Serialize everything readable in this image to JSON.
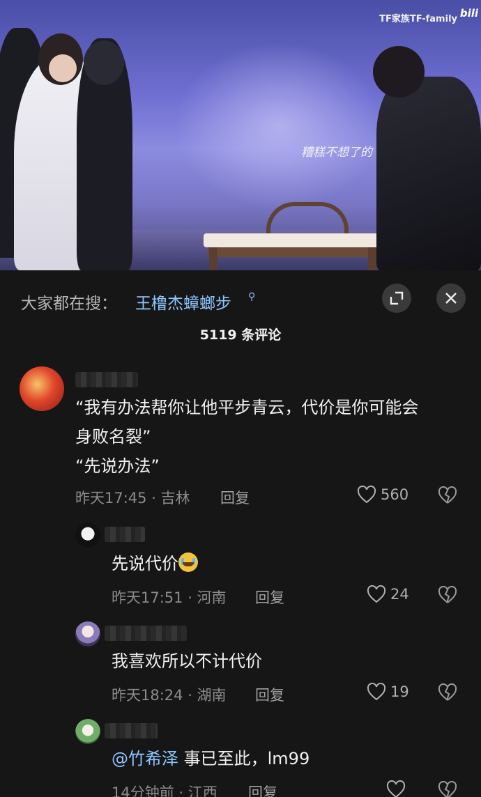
{
  "video": {
    "watermark": "TF家族TF-family",
    "platform_logo": "bilibili",
    "calligraphy": "糟糕不想了的"
  },
  "search": {
    "prefix": "大家都在搜：",
    "term": "王橹杰蟑螂步"
  },
  "comments_header": {
    "count_label": "5119 条评论"
  },
  "comments": [
    {
      "lines": [
        "“我有办法帮你让他平步青云，代价是你可能会",
        "身败名裂”",
        "“先说办法”"
      ],
      "meta": "昨天17:45 · 吉林",
      "reply_label": "回复",
      "likes": "560"
    },
    {
      "text": "先说代价",
      "meta": "昨天17:51 · 河南",
      "reply_label": "回复",
      "likes": "24"
    },
    {
      "text": "我喜欢所以不计代价",
      "meta": "昨天18:24 · 湖南",
      "reply_label": "回复",
      "likes": "19"
    },
    {
      "mention": "@竹希泽",
      "text": " 事已至此，lm99",
      "meta": "14分钟前 · 江西",
      "reply_label": "回复"
    }
  ],
  "colors": {
    "background": "#161616",
    "link": "#8ec6ff"
  }
}
